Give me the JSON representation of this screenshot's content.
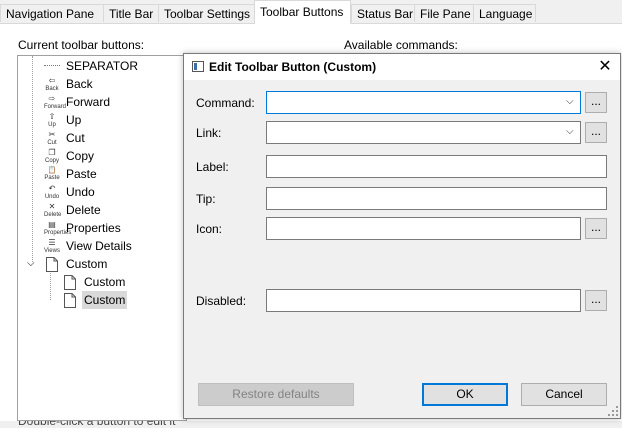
{
  "tabs": [
    {
      "label": "Navigation Pane"
    },
    {
      "label": "Title Bar"
    },
    {
      "label": "Toolbar Settings"
    },
    {
      "label": "Toolbar Buttons"
    },
    {
      "label": "Status Bar"
    },
    {
      "label": "File Pane"
    },
    {
      "label": "Language"
    }
  ],
  "panel": {
    "current_label": "Current toolbar buttons:",
    "available_label": "Available commands:",
    "bottom_text": "Double-click a button to edit it"
  },
  "tree": {
    "items": [
      {
        "label": "SEPARATOR",
        "icon": "separator-icon",
        "glyph": "",
        "caption": ""
      },
      {
        "label": "Back",
        "icon": "back-icon",
        "glyph": "⇦",
        "caption": "Back"
      },
      {
        "label": "Forward",
        "icon": "forward-icon",
        "glyph": "⇨",
        "caption": "Forward"
      },
      {
        "label": "Up",
        "icon": "up-icon",
        "glyph": "⇧",
        "caption": "Up"
      },
      {
        "label": "Cut",
        "icon": "cut-icon",
        "glyph": "✂",
        "caption": "Cut"
      },
      {
        "label": "Copy",
        "icon": "copy-icon",
        "glyph": "❐",
        "caption": "Copy"
      },
      {
        "label": "Paste",
        "icon": "paste-icon",
        "glyph": "📋",
        "caption": "Paste"
      },
      {
        "label": "Undo",
        "icon": "undo-icon",
        "glyph": "↶",
        "caption": "Undo"
      },
      {
        "label": "Delete",
        "icon": "delete-icon",
        "glyph": "✕",
        "caption": "Delete"
      },
      {
        "label": "Properties",
        "icon": "properties-icon",
        "glyph": "▤",
        "caption": "Properties"
      },
      {
        "label": "View Details",
        "icon": "view-details-icon",
        "glyph": "☰",
        "caption": "Views"
      },
      {
        "label": "Custom",
        "icon": "file-icon",
        "glyph": "",
        "caption": ""
      },
      {
        "label": "Custom",
        "icon": "file-icon",
        "glyph": "",
        "caption": ""
      },
      {
        "label": "Custom",
        "icon": "file-icon",
        "glyph": "",
        "caption": ""
      }
    ]
  },
  "dialog": {
    "title": "Edit Toolbar Button (Custom)",
    "close_glyph": "✕",
    "fields": {
      "command": {
        "label": "Command:",
        "value": ""
      },
      "link": {
        "label": "Link:",
        "value": ""
      },
      "label": {
        "label": "Label:",
        "value": ""
      },
      "tip": {
        "label": "Tip:",
        "value": ""
      },
      "icon": {
        "label": "Icon:",
        "value": ""
      },
      "disabled": {
        "label": "Disabled:",
        "value": ""
      }
    },
    "browse_label": "...",
    "dropdown_glyph": "⌵",
    "buttons": {
      "restore": "Restore defaults",
      "ok": "OK",
      "cancel": "Cancel"
    },
    "accent_color": "#0078d7"
  }
}
